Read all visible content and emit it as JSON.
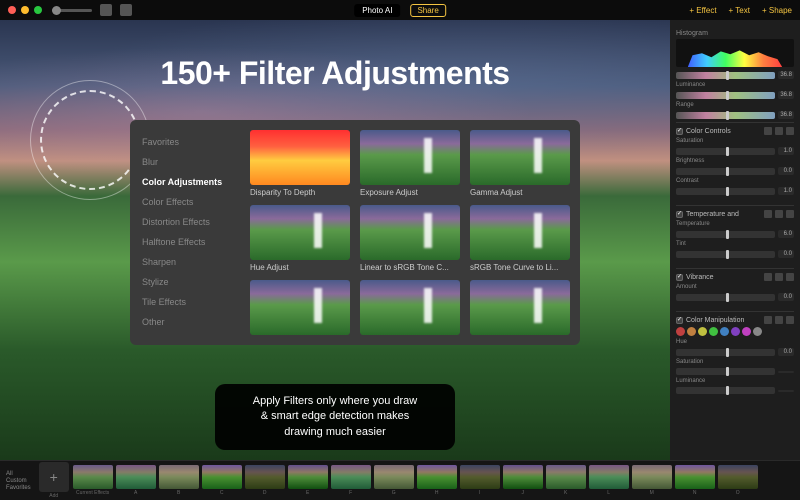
{
  "app": {
    "name": "Photo AI",
    "share_label": "Share"
  },
  "toolbar": {
    "effect": "+ Effect",
    "text": "+ Text",
    "shape": "+ Shape"
  },
  "headline": "150+ Filter Adjustments",
  "filter_panel": {
    "categories": [
      "Favorites",
      "Blur",
      "Color Adjustments",
      "Color Effects",
      "Distortion Effects",
      "Halftone Effects",
      "Sharpen",
      "Stylize",
      "Tile Effects",
      "Other"
    ],
    "active_category_index": 2,
    "filters": [
      "Disparity To Depth",
      "Exposure Adjust",
      "Gamma Adjust",
      "Hue Adjust",
      "Linear to sRGB Tone C...",
      "sRGB Tone Curve to Li..."
    ]
  },
  "tooltip": {
    "line1": "Apply Filters only where you draw",
    "line2": "& smart edge detection makes",
    "line3": "drawing much easier"
  },
  "sidepanel": {
    "histogram_title": "Histogram",
    "luminance_label": "Luminance",
    "range_label": "Range",
    "groups": [
      {
        "title": "Color Controls",
        "checked": true,
        "sliders": [
          {
            "label": "Saturation",
            "value": "1.0"
          },
          {
            "label": "Brightness",
            "value": "0.0"
          },
          {
            "label": "Contrast",
            "value": "1.0"
          }
        ]
      },
      {
        "title": "Temperature and",
        "checked": true,
        "sliders": [
          {
            "label": "Temperature",
            "value": "6.0"
          },
          {
            "label": "Tint",
            "value": "0.0"
          }
        ]
      },
      {
        "title": "Vibrance",
        "checked": true,
        "sliders": [
          {
            "label": "Amount",
            "value": "0.0"
          }
        ]
      },
      {
        "title": "Color Manipulation",
        "checked": true,
        "colors": [
          "#c04040",
          "#c08040",
          "#c0c040",
          "#40c040",
          "#4080c0",
          "#8040c0",
          "#c040c0",
          "#888"
        ],
        "sliders": [
          {
            "label": "Hue",
            "value": "0.0"
          },
          {
            "label": "Saturation",
            "value": ""
          },
          {
            "label": "Luminance",
            "value": ""
          }
        ]
      }
    ],
    "default_slider_value": "36.8"
  },
  "footer": {
    "left_labels": [
      "All",
      "Custom",
      "Favorites"
    ],
    "add_label": "+",
    "add_sublabel": "Add",
    "thumbs": [
      "Current Effects",
      "A",
      "B",
      "C",
      "D",
      "E",
      "F",
      "G",
      "H",
      "I",
      "J",
      "K",
      "L",
      "M",
      "N",
      "O"
    ]
  }
}
